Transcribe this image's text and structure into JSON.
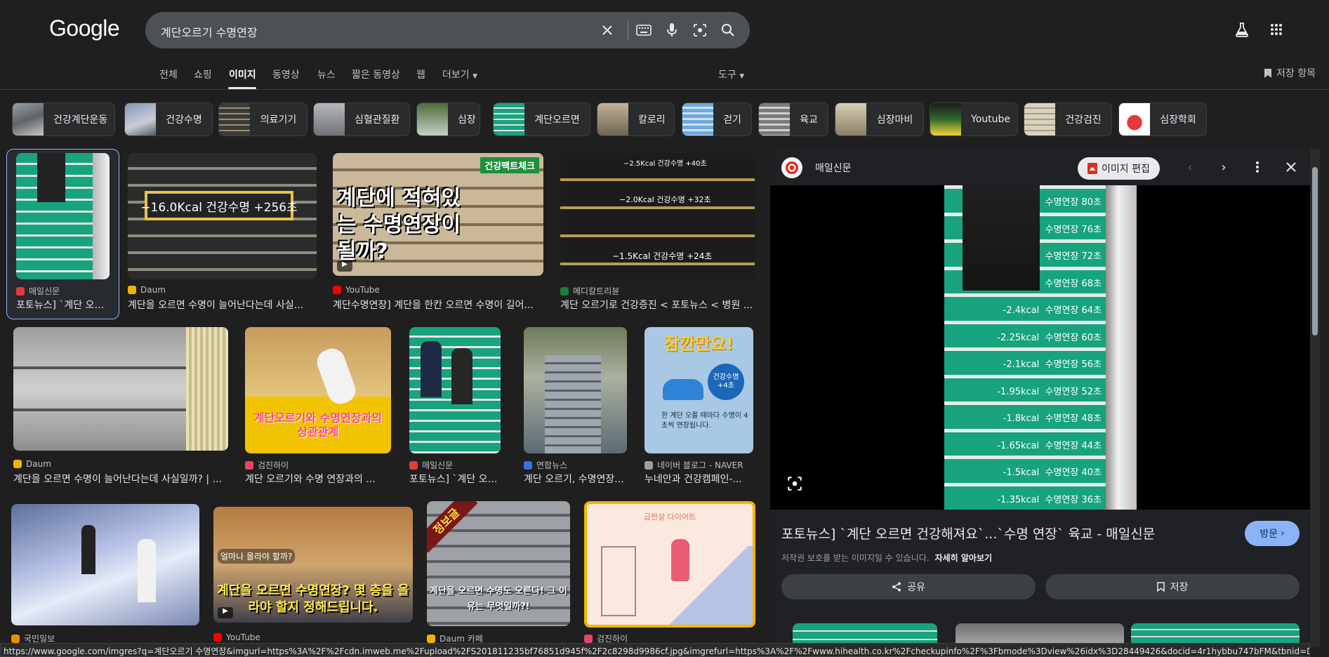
{
  "logo": "Google",
  "search": {
    "query": "계단오르기 수명연장"
  },
  "tabs": {
    "all": "전체",
    "shopping": "쇼핑",
    "images": "이미지",
    "videos": "동영상",
    "news": "뉴스",
    "short_videos": "짧은 동영상",
    "web": "웹",
    "more": "더보기",
    "tools": "도구",
    "saved": "저장 항목"
  },
  "chips": [
    "건강계단운동",
    "건강수명",
    "의료기기",
    "심혈관질환",
    "심장",
    "계단오르면",
    "칼로리",
    "걷기",
    "육교",
    "심장마비",
    "Youtube",
    "건강검진",
    "심장학회"
  ],
  "results": [
    {
      "source": "매일신문",
      "title": "포토뉴스] `계단 오르...",
      "fav": "#e33b3b"
    },
    {
      "source": "Daum",
      "title": "계단을 오르면 수명이 늘어난다는데 사실...",
      "fav": "#f0b400"
    },
    {
      "source": "YouTube",
      "title": "계단수명연장] 계단을 한칸 오르면 수명이 길어...",
      "fav": "#ff0000"
    },
    {
      "source": "메디칼트리뷴",
      "title": "계단 오르기로 건강증진 < 포토뉴스 < 병원 ...",
      "fav": "#1a7f37"
    },
    {
      "source": "Daum",
      "title": "계단을 오르면 수명이 늘어난다는데 사실일까? | ...",
      "fav": "#f0b400"
    },
    {
      "source": "검진하이",
      "title": "계단 오르기와 수명 연장과의 ...",
      "fav": "#e8446b"
    },
    {
      "source": "매일신문",
      "title": "포토뉴스] `계단 오르...",
      "fav": "#e33b3b"
    },
    {
      "source": "연합뉴스",
      "title": "계단 오르기, 수명연장...",
      "fav": "#3b6fe3"
    },
    {
      "source": "네이버 블로그 - NAVER",
      "title": "누네안과 건강캠페인-...",
      "fav": "#9aa0a6"
    },
    {
      "source": "국민일보",
      "title": "",
      "fav": "#f08c00"
    },
    {
      "source": "YouTube",
      "title": "",
      "fav": "#ff0000"
    },
    {
      "source": "Daum 카페",
      "title": "",
      "fav": "#f0b400"
    },
    {
      "source": "검진하이",
      "title": "",
      "fav": "#e8446b"
    }
  ],
  "image_text": {
    "r1_2": "−16.0Kcal 건강수명 +256초",
    "r1_3_main": "계단에 적혀있는 수명연장이 될까?",
    "r1_3_tag": "건강팩트체크",
    "r1_4_a": "−2.5Kcal 건강수명 +40초",
    "r1_4_b": "−2.0Kcal 건강수명 +32초",
    "r1_4_c": "−1.5Kcal 건강수명 +24초",
    "r2_2": "계단오르기와 수명연장과의 상관관계",
    "r2_5_top": "잠깐만요!",
    "r2_5_badge": "건강수명 +4초",
    "r2_5_text": "한 계단 오를 때마다 수명이 4초씩 연장됩니다.",
    "r3_2_q": "얼마나 올라야 할까?",
    "r3_2_main": "계단을 오르면 수명연장? 몇 층을 올라야 할지 정해드립니다.",
    "r3_3_tag": "정보글",
    "r3_3_main": "계단을 오르면 수명도 오른다! 그 이유는 무엇일까?!",
    "r3_4_tag": "급찐살 다이어트"
  },
  "panel": {
    "source": "매일신문",
    "edit_label": "이미지 편집",
    "title": "포토뉴스] `계단 오르면 건강해져요`...`수명 연장` 육교 - 매일신문",
    "copyright": "저작권 보호를 받는 이미지일 수 있습니다.",
    "learn_more": "자세히 알아보기",
    "visit": "방문",
    "share": "공유",
    "save": "저장",
    "steps": [
      "수명연장 80초",
      "수명연장 76초",
      "수명연장 72초",
      "수명연장 68초",
      "-2.4kcal  수명연장 64초",
      "-2.25kcal  수명연장 60초",
      "-2.1kcal  수명연장 56초",
      "-1.95kcal  수명연장 52초",
      "-1.8kcal  수명연장 48초",
      "-1.65kcal  수명연장 44초",
      "-1.5kcal  수명연장 40초",
      "-1.35kcal  수명연장 36초"
    ]
  },
  "status_url": "https://www.google.com/imgres?q=계단오르기 수명연장&imgurl=https%3A%2F%2Fcdn.imweb.me%2Fupload%2FS201811235bf76851d945f%2F2c8298d9986cf.jpg&imgrefurl=https%3A%2F%2Fwww.hihealth.co.kr%2Fcheckupinfo%2F%3Fbmode%3Dview%26idx%3D28449426&docid=4r1hybbu747bFM&tbnid=DvYS93sP2OC-7M&vet=12ahUKE..."
}
